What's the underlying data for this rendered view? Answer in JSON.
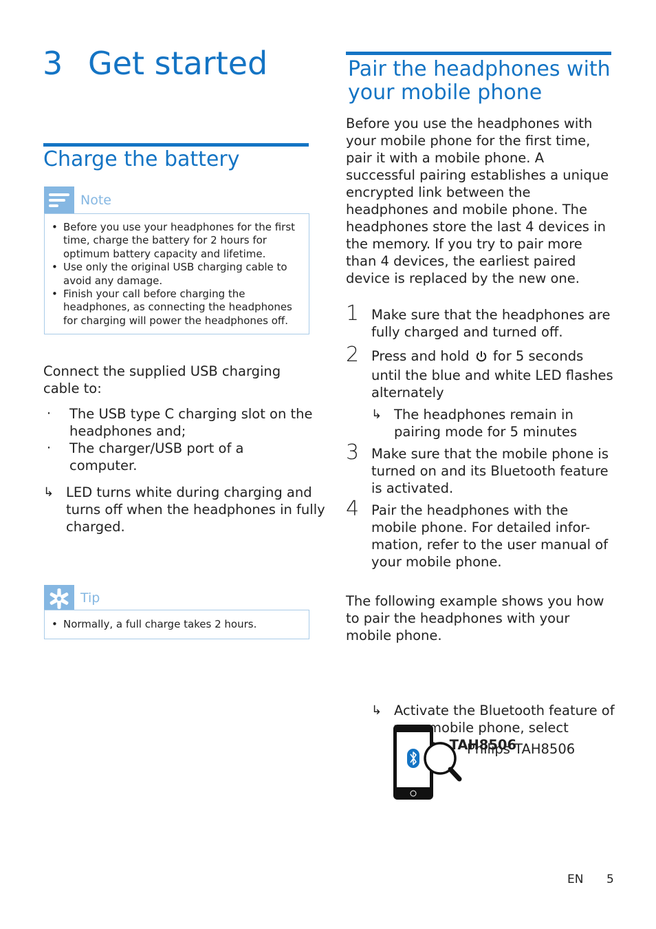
{
  "chapter": {
    "number": "3",
    "title": "Get started"
  },
  "left_column": {
    "section_title": "Charge the battery",
    "note": {
      "label": "Note",
      "icon": "note-icon",
      "items": [
        "Before you use your headphones for the first time, charge the battery for 2 hours for optimum battery capacity and lifetime.",
        "Use only the original USB charging cable to avoid any damage.",
        "Finish your call before charging the headphones, as connecting the headphones for charging will power the headphones off."
      ]
    },
    "intro": "Connect the supplied USB charging cable to:",
    "bullets": [
      "The USB type C charging slot on the headphones and;",
      "The charger/USB port of a computer."
    ],
    "result": "LED turns white during charging and turns off when the headphones in fully charged.",
    "tip": {
      "label": "Tip",
      "icon": "tip-asterisk-icon",
      "items": [
        "Normally, a full charge takes 2 hours."
      ]
    }
  },
  "right_column": {
    "section_title": "Pair the headphones with your mobile phone",
    "intro": "Before you use the headphones with your mobile phone for the first time, pair it with a mobile phone. A successful pairing establishes a unique encrypted link between the headphones and mobile phone. The headphones store the last 4 devices in the memory. If you try to pair more than 4 devices, the earliest paired device is replaced by the new one.",
    "steps": [
      {
        "number": "1",
        "text": "Make sure that the headphones are fully charged and turned off."
      },
      {
        "number": "2",
        "text_before": "Press and hold",
        "icon": "power-icon",
        "text_after": "for 5 seconds until the blue and white LED flashes alternately",
        "result": "The headphones remain in pairing mode for 5 minutes"
      },
      {
        "number": "3",
        "text": "Make sure that the mobile phone is turned on and its Bluetooth feature is activated."
      },
      {
        "number": "4",
        "text": "Pair the headphones with the mobile phone. For detailed infor-mation, refer to the user manual of your mobile phone."
      }
    ],
    "example_intro": "The following example shows you how to pair the headphones with your mobile phone.",
    "example_result_text": "Activate the Bluetooth feature of your mobile phone, select",
    "example_result_bold": "Philips TAH8506",
    "illustration_label": "Philips TAH8506"
  },
  "footer": {
    "language": "EN",
    "page_number": "5"
  },
  "colors": {
    "accent": "#1474c4",
    "callout": "#85b7e2",
    "callout_border": "#a9cbe8",
    "text": "#222222"
  }
}
